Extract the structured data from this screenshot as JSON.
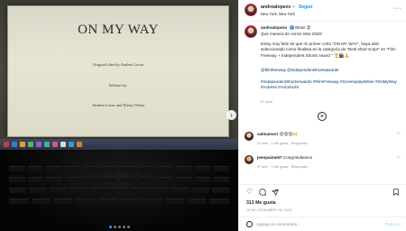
{
  "media": {
    "doc_title": "ON MY WAY",
    "doc_line1": "Original idea by Andrea Lovar",
    "doc_line2": "Written by:",
    "doc_line3": "Andrea Lovar and Elena Viñeta",
    "carousel_count": 5,
    "carousel_active": 1,
    "next_icon": "chevron-right-icon"
  },
  "header": {
    "username": "andrealopezv",
    "separator": "•",
    "follow_label": "Seguir",
    "location": "New York, New York",
    "more_icon": "more-horizontal-icon"
  },
  "caption": {
    "username": "andrealopezv",
    "text1": "Wow! 😍",
    "text2": "Qué manera de cerrar este 2020!",
    "text3": "Estoy muy feliz de que mi primer corto \"ON MY WAY\", haya sido seleccionado como finalista en la categoría de \"Best short script\" en \"Film Freeway + Independent Shorts Award \" 🏆🎬🙏",
    "mentions": "@filmfreeway @independentshortsawards",
    "hashtags": "#IndependentShortsAwards #FilmFreeway #ScreenplayWriter #OnMyWay #Actress #ActorsLife",
    "time": "67 sem"
  },
  "comments": [
    {
      "username": "salmamorr",
      "text": "😍😍😍🙌",
      "time": "67 sem",
      "likes": "1 Me gusta",
      "reply": "Responder"
    },
    {
      "username": "jeenpaime57",
      "text": "Congratulations",
      "time": "67 sem",
      "likes": "1 Me gusta",
      "reply": "Responder"
    }
  ],
  "load_more_icon": "plus-circle-icon",
  "actions": {
    "like_icon": "heart-icon",
    "comment_icon": "comment-icon",
    "share_icon": "paper-plane-icon",
    "save_icon": "bookmark-icon"
  },
  "likes": "313 Me gusta",
  "date": "18 DE DICIEMBRE DE 2020",
  "add_comment": {
    "placeholder": "Agrega un comentario...",
    "publish_label": "Publicar"
  },
  "colors": {
    "accent": "#0095f6",
    "verified": "#3897f0",
    "text": "#262626",
    "muted": "#8e8e8e"
  }
}
